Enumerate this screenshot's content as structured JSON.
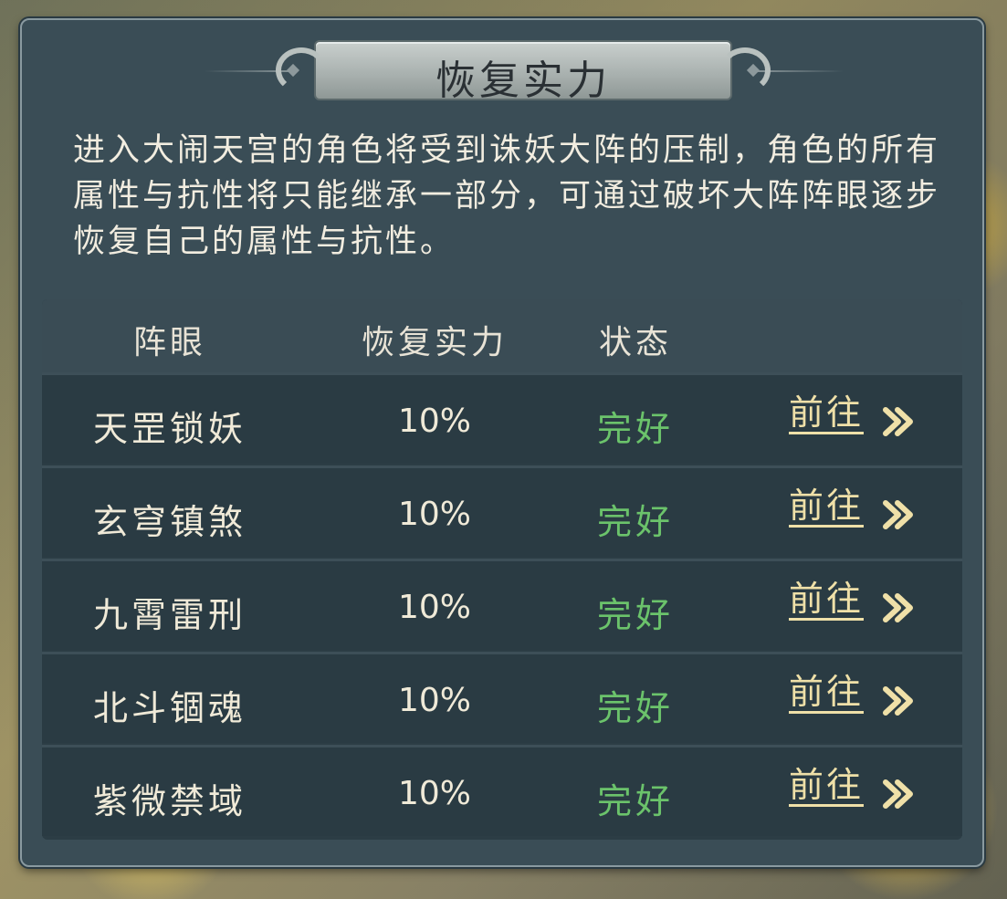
{
  "dialog": {
    "title": "恢复实力",
    "description": "进入大闹天宫的角色将受到诛妖大阵的压制，角色的所有属性与抗性将只能继承一部分，可通过破坏大阵阵眼逐步恢复自己的属性与抗性。"
  },
  "table": {
    "headers": [
      "阵眼",
      "恢复实力",
      "状态"
    ],
    "rows": [
      {
        "name": "天罡锁妖",
        "recovery": "10%",
        "status": "完好",
        "action": "前往"
      },
      {
        "name": "玄穹镇煞",
        "recovery": "10%",
        "status": "完好",
        "action": "前往"
      },
      {
        "name": "九霄雷刑",
        "recovery": "10%",
        "status": "完好",
        "action": "前往"
      },
      {
        "name": "北斗锢魂",
        "recovery": "10%",
        "status": "完好",
        "action": "前往"
      },
      {
        "name": "紫微禁域",
        "recovery": "10%",
        "status": "完好",
        "action": "前往"
      }
    ]
  },
  "colors": {
    "panel_bg": "#3a4d56",
    "status_good": "#6bc36b",
    "link_gold": "#efe0a8"
  },
  "icons": {
    "goto": "double-chevron-right-icon"
  }
}
